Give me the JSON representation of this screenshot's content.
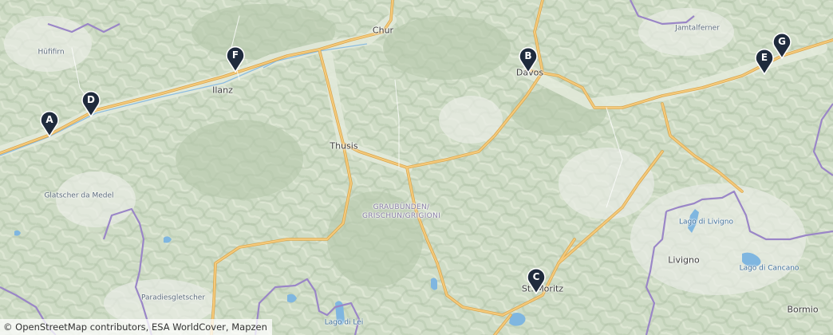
{
  "map": {
    "places": [
      {
        "id": "chur",
        "label": "Chur"
      },
      {
        "id": "davos",
        "label": "Davos"
      },
      {
        "id": "ilanz",
        "label": "Ilanz"
      },
      {
        "id": "thusis",
        "label": "Thusis"
      },
      {
        "id": "st-moritz",
        "label": "St. Moritz"
      },
      {
        "id": "livigno",
        "label": "Livigno"
      },
      {
        "id": "bormio",
        "label": "Bormio"
      },
      {
        "id": "hufifirn",
        "label": "Hüfifirn"
      },
      {
        "id": "glatscher-da-medel",
        "label": "Glatscher da Medel"
      },
      {
        "id": "paradiesgletscher",
        "label": "Paradiesgletscher"
      },
      {
        "id": "jamtalferner",
        "label": "Jamtalferner"
      },
      {
        "id": "lago-di-livigno",
        "label": "Lago di Livigno"
      },
      {
        "id": "lago-di-cancano",
        "label": "Lago di Cancano"
      },
      {
        "id": "lago-di-lei",
        "label": "Lago di Lei"
      }
    ],
    "region_label": [
      "GRAUBÜNDEN/",
      "GRISCHUN/GRIGIONI"
    ],
    "markers": [
      {
        "letter": "A"
      },
      {
        "letter": "B"
      },
      {
        "letter": "C"
      },
      {
        "letter": "D"
      },
      {
        "letter": "E"
      },
      {
        "letter": "F"
      },
      {
        "letter": "G"
      }
    ],
    "attribution": "© OpenStreetMap contributors, ESA WorldCover, Mapzen",
    "colors": {
      "terrain": "#cfdcc6",
      "terrain_dark": "#a9bca2",
      "valley": "#e6ece0",
      "road": "#f4c97a",
      "road_outline": "#d9a44a",
      "border": "#9a86c7",
      "water": "#7fb6e0",
      "marker": "#1f2b3d"
    }
  }
}
